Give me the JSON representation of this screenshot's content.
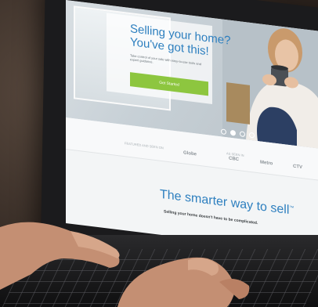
{
  "website": {
    "hero_title_line1": "Selling your home?",
    "hero_title_line2": "You've got this!",
    "hero_body": "Take control of your sale with easy-to-use tools and expert guidance.",
    "hero_button": "Get Started",
    "as_seen_label": "FEATURED AND SEEN ON",
    "as_seen_label2": "AS SEEN IN",
    "logos": [
      "Globe",
      "CBC",
      "Metro",
      "CTV"
    ],
    "tagline": "The smarter way to sell",
    "tagline_mark": "™",
    "subline": "Selling your home doesn't have to be complicated.",
    "carousel_dots": 4,
    "carousel_active": 1
  },
  "colors": {
    "brand_blue": "#2d7fbf",
    "accent_green": "#8dc63f"
  }
}
